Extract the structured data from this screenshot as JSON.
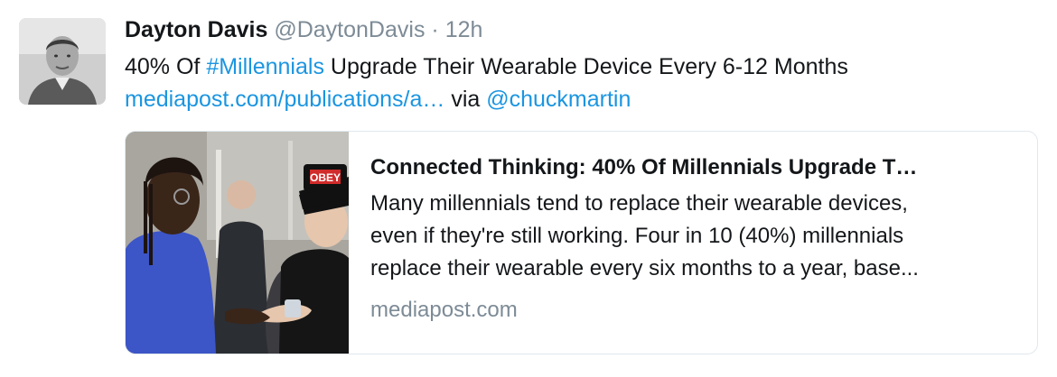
{
  "tweet": {
    "author_name": "Dayton Davis",
    "author_handle": "@DaytonDavis",
    "separator": "·",
    "timestamp": "12h",
    "text_prefix": "40% Of ",
    "hashtag": "#Millennials",
    "text_suffix": " Upgrade Their Wearable Device Every 6-12 Months",
    "url": "mediapost.com/publications/a…",
    "via_text": "via",
    "mention": "@chuckmartin"
  },
  "card": {
    "title": "Connected Thinking: 40% Of Millennials Upgrade T…",
    "description": "Many millennials tend to replace their wearable devices,\neven if they're still working. Four in 10 (40%) millennials\nreplace their wearable every six months to a year, base...",
    "domain": "mediapost.com",
    "image_cap_text": "OBEY"
  },
  "colors": {
    "link": "#1b95e0",
    "muted": "#7d8b96",
    "text": "#14171a",
    "border": "#e1e8ed"
  }
}
